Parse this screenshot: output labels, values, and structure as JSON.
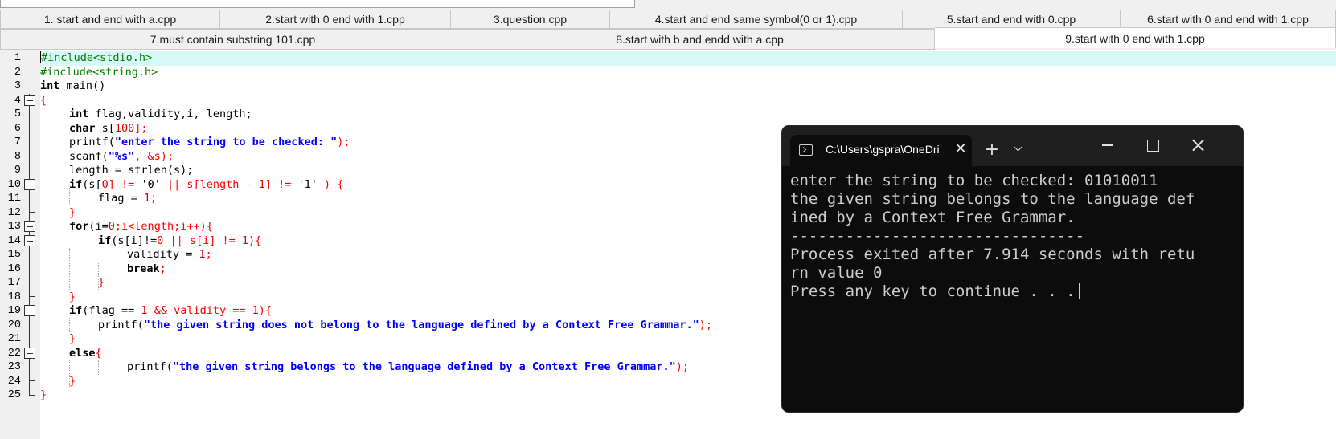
{
  "tabs_row1": [
    "1. start and end with a.cpp",
    "2.start with 0 end with 1.cpp",
    "3.question.cpp",
    "4.start and end same symbol(0 or 1).cpp",
    "5.start and end with 0.cpp",
    "6.start with 0 and end with 1.cpp"
  ],
  "tabs_row2": [
    "7.must contain substring 101.cpp",
    "8.start with b and endd with a.cpp",
    "9.start with 0 end with 1.cpp"
  ],
  "active_tab": "9.start with 0 end with 1.cpp",
  "line_numbers": [
    "1",
    "2",
    "3",
    "4",
    "5",
    "6",
    "7",
    "8",
    "9",
    "10",
    "11",
    "12",
    "13",
    "14",
    "15",
    "16",
    "17",
    "18",
    "19",
    "20",
    "21",
    "22",
    "23",
    "24",
    "25"
  ],
  "code": {
    "l1": "#include<stdio.h>",
    "l2": "#include<string.h>",
    "l3_kw": "int",
    "l3_rest": " main()",
    "l4": "{",
    "l5_kw": "int",
    "l5_rest": " flag,validity,i, length;",
    "l6_kw": "char",
    "l6_a": " s[",
    "l6_num": "100",
    "l6_b": "];",
    "l7_fn": "printf(",
    "l7_str": "\"enter the string to be checked: \"",
    "l7_end": ");",
    "l8_fn": "scanf(",
    "l8_str": "\"%s\"",
    "l8_end": ", &s);",
    "l9": "length = strlen(s);",
    "l10_kw": "if",
    "l10_a": "(s[",
    "l10_n0": "0",
    "l10_b": "] != ",
    "l10_c0": "'0'",
    "l10_c": " || s[length - ",
    "l10_n1": "1",
    "l10_d": "] != ",
    "l10_c1": "'1'",
    "l10_e": " ) {",
    "l11_a": "flag = ",
    "l11_n": "1",
    "l11_b": ";",
    "l12": "}",
    "l13_kw": "for",
    "l13_a": "(i=",
    "l13_n": "0",
    "l13_b": ";i<length;i++){",
    "l14_kw": "if",
    "l14_a": "(s[i]!=",
    "l14_n0": "0",
    "l14_b": " || s[i] != ",
    "l14_n1": "1",
    "l14_c": "){",
    "l15_a": "validity = ",
    "l15_n": "1",
    "l15_b": ";",
    "l16_kw": "break",
    "l16_b": ";",
    "l17": "}",
    "l18": "}",
    "l19_kw": "if",
    "l19_a": "(flag == ",
    "l19_n0": "1",
    "l19_b": " && validity == ",
    "l19_n1": "1",
    "l19_c": "){",
    "l20_fn": "printf(",
    "l20_str": "\"the given string does not belong to the language defined by a Context Free Grammar.\"",
    "l20_end": ");",
    "l21": "}",
    "l22_kw": "else",
    "l22_b": "{",
    "l23_fn": "printf(",
    "l23_str": "\"the given string belongs to the language defined by a Context Free Grammar.\"",
    "l23_end": ");",
    "l24": "}",
    "l25": "}"
  },
  "terminal": {
    "tab_title": "C:\\Users\\gspra\\OneDri",
    "lines": [
      "enter the string to be checked: 01010011",
      "the given string belongs to the language def",
      "ined by a Context Free Grammar.",
      "--------------------------------",
      "Process exited after 7.914 seconds with retu",
      "rn value 0",
      "Press any key to continue . . ."
    ],
    "icons": {
      "tab": "terminal-icon",
      "close_tab": "close-icon",
      "new_tab": "plus-icon",
      "dropdown": "chevron-down-icon",
      "minimize": "minimize-icon",
      "maximize": "maximize-icon",
      "close_window": "close-icon"
    }
  },
  "colors": {
    "current_line": "#d8f8f8",
    "preprocessor": "#008000",
    "string": "#0000ff",
    "number": "#e00000",
    "terminal_bg": "#0c0c0c",
    "terminal_text": "#cccccc"
  }
}
